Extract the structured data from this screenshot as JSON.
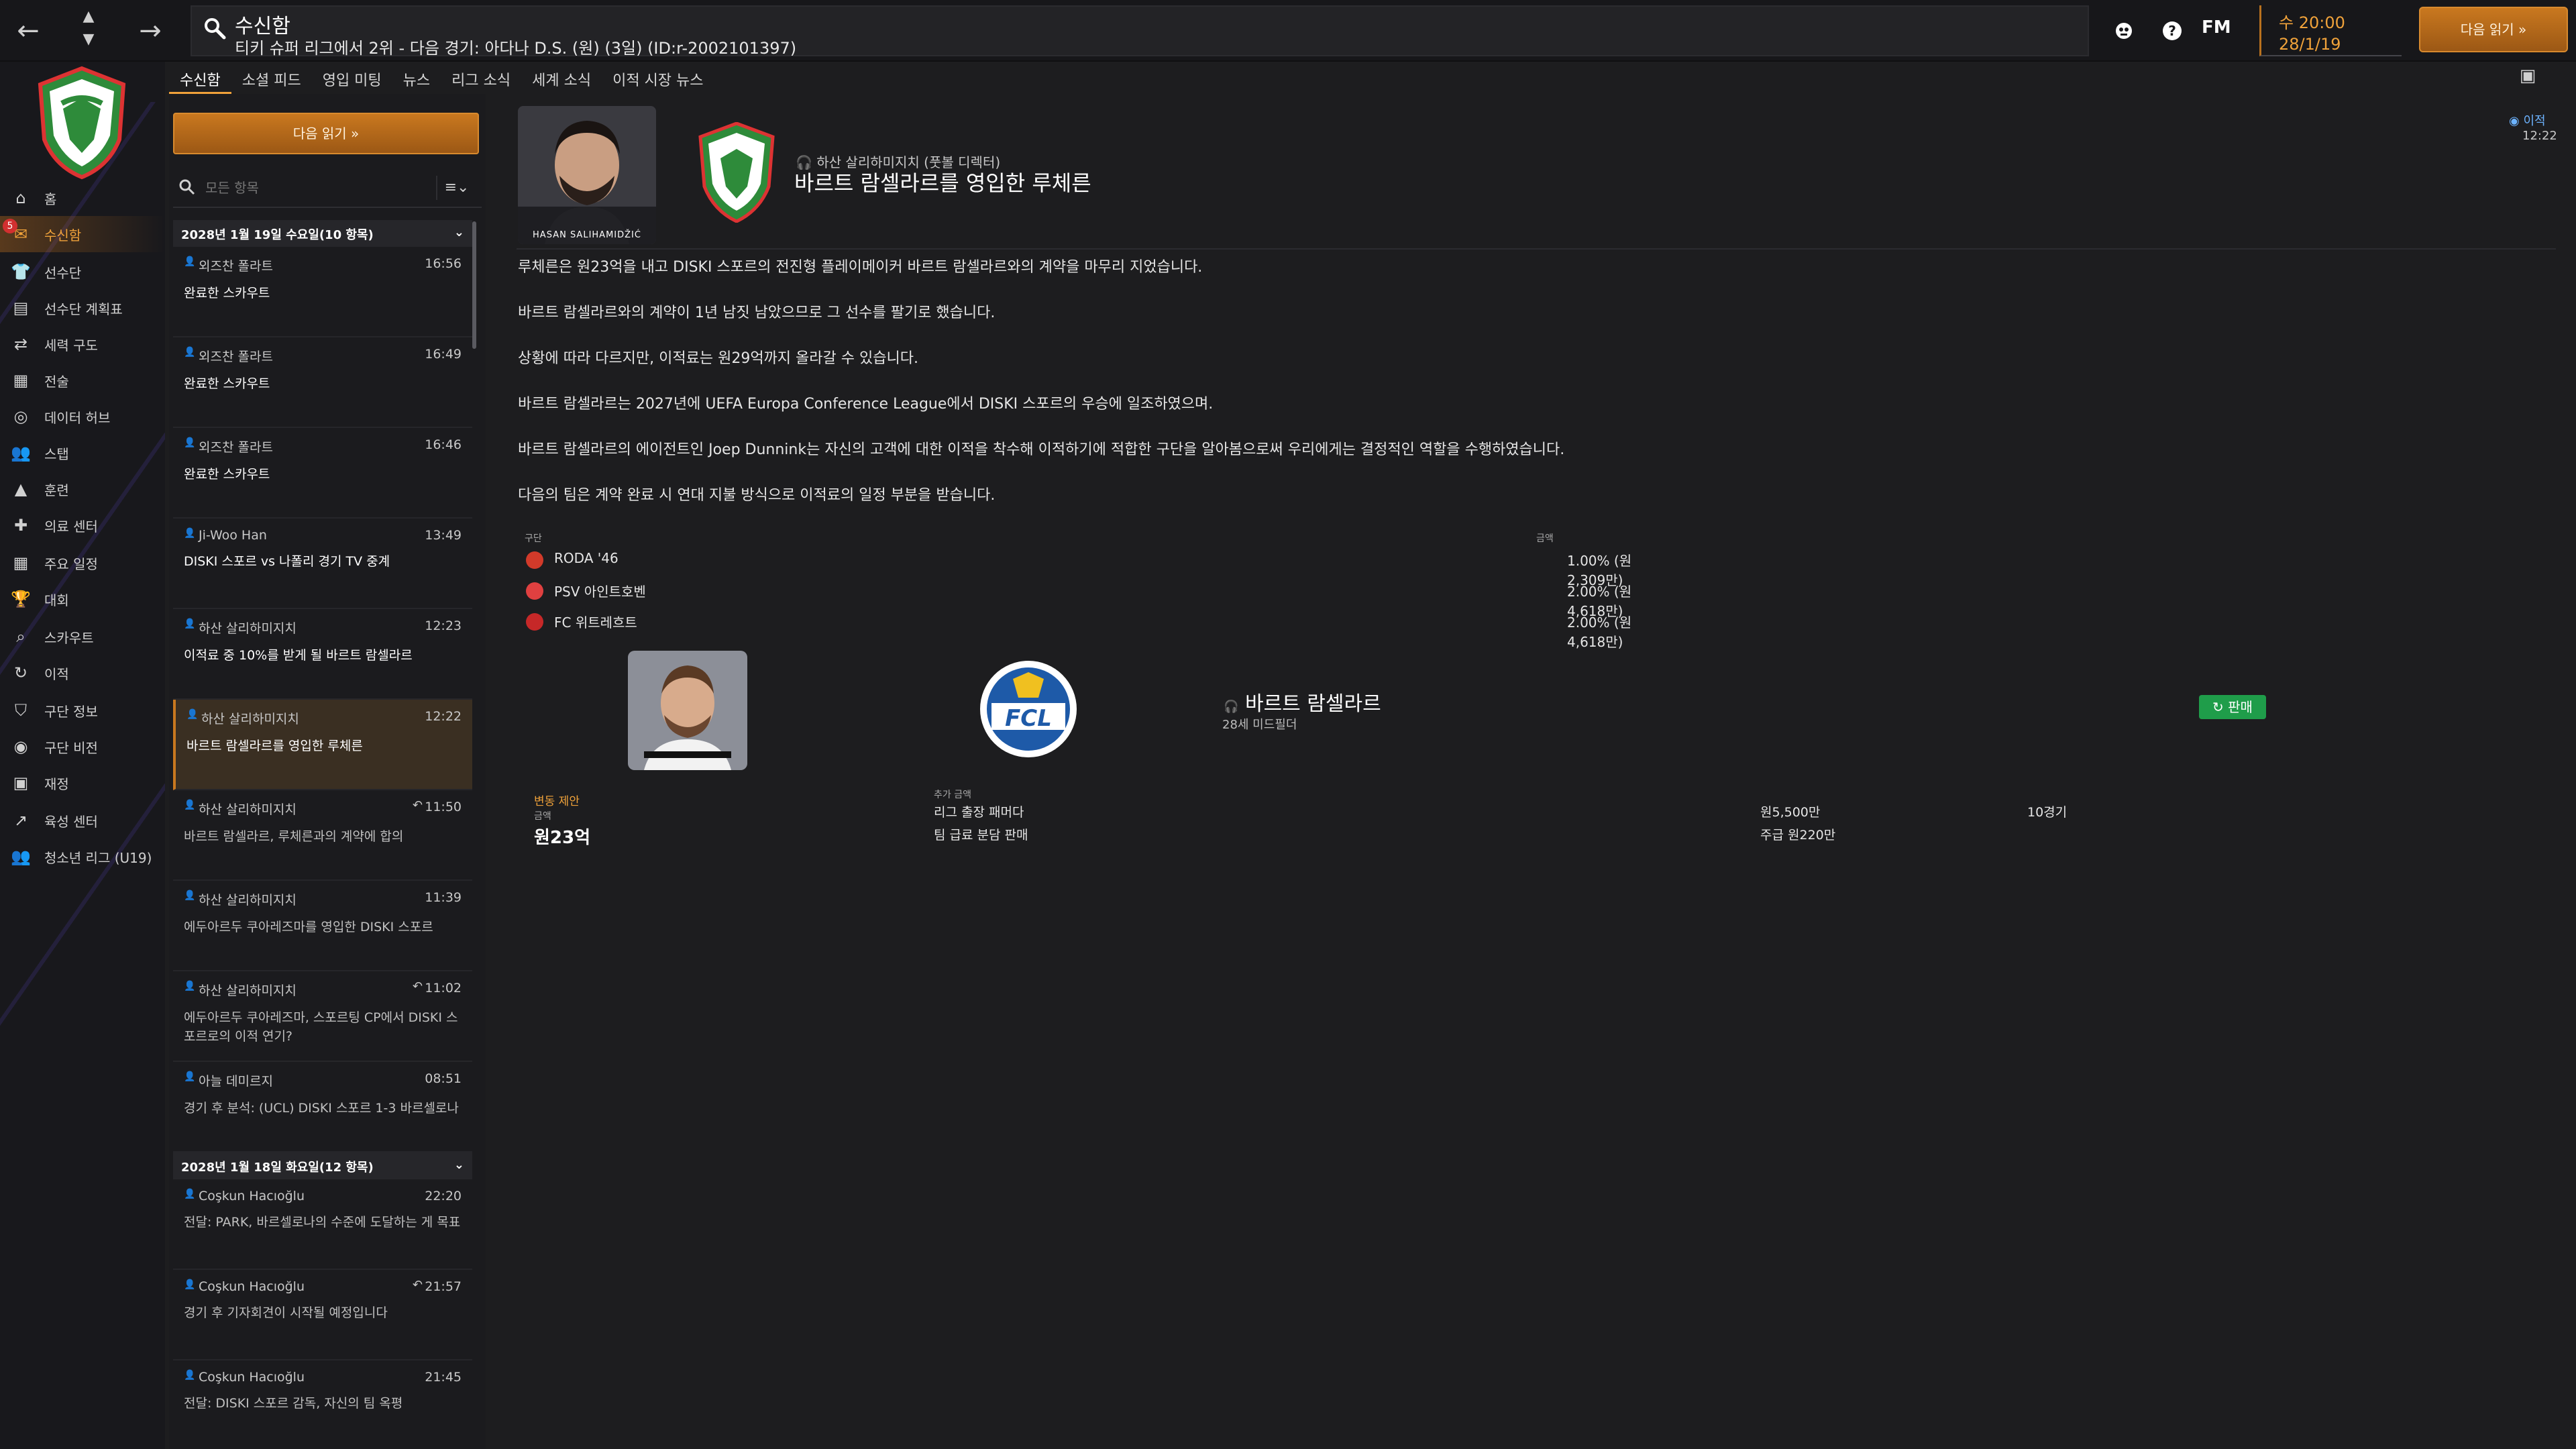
{
  "topbar": {
    "back_label": "←",
    "forward_label": "→",
    "title": "수신함",
    "subtitle": "티키 슈퍼 리그에서 2위 - 다음 경기: 아다나 D.S. (원) (3일) (ID:r-2002101397)",
    "fm_label": "FM",
    "date_time": "수 20:00",
    "date_date": "28/1/19",
    "continue_label": "다음 읽기 »"
  },
  "sidebar": {
    "inbox_badge": "5",
    "items": [
      {
        "label": "홈",
        "icon": "home-icon"
      },
      {
        "label": "수신함",
        "icon": "inbox-icon"
      },
      {
        "label": "선수단",
        "icon": "squad-icon"
      },
      {
        "label": "선수단 계획표",
        "icon": "planner-icon"
      },
      {
        "label": "세력 구도",
        "icon": "dynamics-icon"
      },
      {
        "label": "전술",
        "icon": "tactics-icon"
      },
      {
        "label": "데이터 허브",
        "icon": "data-hub-icon"
      },
      {
        "label": "스탭",
        "icon": "staff-icon"
      },
      {
        "label": "훈련",
        "icon": "training-icon"
      },
      {
        "label": "의료 센터",
        "icon": "medical-icon"
      },
      {
        "label": "주요 일정",
        "icon": "calendar-icon"
      },
      {
        "label": "대회",
        "icon": "trophy-icon"
      },
      {
        "label": "스카우트",
        "icon": "scout-icon"
      },
      {
        "label": "이적",
        "icon": "transfer-icon"
      },
      {
        "label": "구단 정보",
        "icon": "club-info-icon"
      },
      {
        "label": "구단 비전",
        "icon": "club-vision-icon"
      },
      {
        "label": "재정",
        "icon": "finance-icon"
      },
      {
        "label": "육성 센터",
        "icon": "development-icon"
      },
      {
        "label": "청소년 리그 (U19)",
        "icon": "youth-icon"
      }
    ]
  },
  "tabs": [
    "수신함",
    "소셜 피드",
    "영입 미팅",
    "뉴스",
    "리그 소식",
    "세계 소식",
    "이적 시장 뉴스"
  ],
  "inbox": {
    "continue_label": "다음 읽기 »",
    "filter_placeholder": "모든 항목",
    "sort_label": "≡⌄",
    "day1": "2028년 1월 19일 수요일(10 항목)",
    "day2": "2028년 1월 18일 화요일(12 항목)",
    "messages_day1": [
      {
        "from": "외즈찬 폴라트",
        "time": "16:56",
        "subject": "완료한 스카우트",
        "read": false,
        "reply": false
      },
      {
        "from": "외즈찬 폴라트",
        "time": "16:49",
        "subject": "완료한 스카우트",
        "read": false,
        "reply": false
      },
      {
        "from": "외즈찬 폴라트",
        "time": "16:46",
        "subject": "완료한 스카우트",
        "read": false,
        "reply": false
      },
      {
        "from": "Ji-Woo Han",
        "time": "13:49",
        "subject": "DISKI 스포르 vs 나폴리 경기 TV 중계",
        "read": false,
        "reply": false
      },
      {
        "from": "하산 살리하미지치",
        "time": "12:23",
        "subject": "이적료 중 10%를 받게 될 바르트 람셀라르",
        "read": false,
        "reply": false
      },
      {
        "from": "하산 살리하미지치",
        "time": "12:22",
        "subject": "바르트 람셀라르를 영입한 루체른",
        "read": false,
        "reply": false,
        "selected": true
      },
      {
        "from": "하산 살리하미지치",
        "time": "11:50",
        "subject": "바르트 람셀라르, 루체른과의 계약에 합의",
        "read": true,
        "reply": true
      },
      {
        "from": "하산 살리하미지치",
        "time": "11:39",
        "subject": "에두아르두 쿠아레즈마를 영입한 DISKI 스포르",
        "read": true,
        "reply": false
      },
      {
        "from": "하산 살리하미지치",
        "time": "11:02",
        "subject": "에두아르두 쿠아레즈마, 스포르팅 CP에서 DISKI 스포르로의 이적 연기?",
        "read": true,
        "reply": true
      },
      {
        "from": "아늘 데미르지",
        "time": "08:51",
        "subject": "경기 후 분석: (UCL) DISKI 스포르 1-3 바르셀로나",
        "read": true,
        "reply": false
      }
    ],
    "messages_day2": [
      {
        "from": "Coşkun Hacıoğlu",
        "time": "22:20",
        "subject": "전달: PARK, 바르셀로나의 수준에 도달하는 게 목표",
        "read": true,
        "reply": false
      },
      {
        "from": "Coşkun Hacıoğlu",
        "time": "21:57",
        "subject": "경기 후 기자회견이 시작될 예정입니다",
        "read": true,
        "reply": true
      },
      {
        "from": "Coşkun Hacıoğlu",
        "time": "21:45",
        "subject": "전달: DISKI 스포르 감독, 자신의 팀 옥평",
        "read": true,
        "reply": false
      }
    ]
  },
  "article": {
    "photo_caption": "HASAN SALIHAMIDŽIĆ",
    "from": "하산 살리하미지치 (풋볼 디렉터)",
    "title": "바르트 람셀라르를 영입한 루체른",
    "tag": "이적",
    "tag_time": "12:22",
    "paragraphs": [
      "루체른은 원23억을 내고 DISKI 스포르의 전진형 플레이메이커 바르트 람셀라르와의 계약을 마무리 지었습니다.",
      "바르트 람셀라르와의 계약이 1년 남짓 남았으므로 그 선수를 팔기로 했습니다.",
      "상황에 따라 다르지만, 이적료는 원29억까지 올라갈 수 있습니다.",
      "바르트 람셀라르는 2027년에 UEFA Europa Conference League에서 DISKI 스포르의 우승에 일조하였으며.",
      "바르트 람셀라르의 에이전트인 Joep Dunnink는 자신의 고객에 대한 이적을 착수해 이적하기에 적합한 구단을 알아봄으로써 우리에게는 결정적인 역할을 수행하였습니다.",
      "다음의 팀은 계약 완료 시 연대 지불 방식으로 이적료의 일정 부분을 받습니다."
    ],
    "clauses_header_left": "구단",
    "clauses_header_right": "금액",
    "clauses": [
      {
        "club": "RODA '46",
        "value": "1.00% (원2,309만)",
        "color": "#d23a2a"
      },
      {
        "club": "PSV 아인트호벤",
        "value": "2.00% (원4,618만)",
        "color": "#e04040"
      },
      {
        "club": "FC 위트레흐트",
        "value": "2.00% (원4,618만)",
        "color": "#c62828"
      }
    ]
  },
  "transfer": {
    "player_name": "바르트 람셀라르",
    "player_pos": "28세 미드필더",
    "sale_label": "판매",
    "offer_label": "변동 제안",
    "fee_label": "금액",
    "fee": "원23억",
    "extra_header": "추가 금액",
    "extras": [
      {
        "label": "리그 출장 패머다",
        "amount": "원5,500만",
        "detail": "10경기"
      },
      {
        "label": "팀 급료 분담 판매",
        "amount": "주급 원220만",
        "detail": ""
      }
    ]
  }
}
